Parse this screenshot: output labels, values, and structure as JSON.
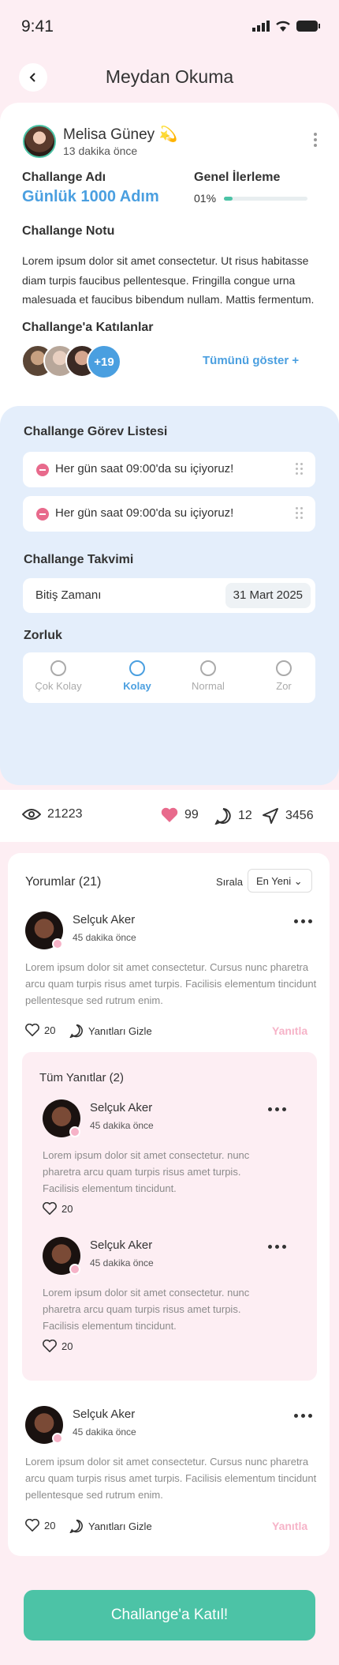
{
  "status": {
    "time": "9:41"
  },
  "header": {
    "title": "Meydan Okuma"
  },
  "post": {
    "user_name": "Melisa Güney",
    "emoji": "💫",
    "time": "13 dakika önce",
    "challenge_name_label": "Challange Adı",
    "challenge_name": "Günlük 1000 Adım",
    "progress_label": "Genel İlerleme",
    "progress_text": "01%",
    "progress_value": 0.1,
    "note_label": "Challange Notu",
    "note": "Lorem ipsum dolor sit amet consectetur. Ut risus habitasse diam turpis faucibus pellentesque. Fringilla congue urna malesuada et faucibus bibendum nullam. Mattis fermentum.",
    "participants_label": "Challange'a Katılanlar",
    "more_count": "+19",
    "show_all": "Tümünü göster +"
  },
  "tasks": {
    "title": "Challange Görev Listesi",
    "items": [
      "Her gün saat 09:00'da su içiyoruz!",
      "Her gün saat 09:00'da su içiyoruz!"
    ]
  },
  "calendar": {
    "title": "Challange Takvimi",
    "end_label": "Bitiş Zamanı",
    "end_value": "31 Mart 2025"
  },
  "difficulty": {
    "title": "Zorluk",
    "options": [
      "Çok Kolay",
      "Kolay",
      "Normal",
      "Zor"
    ],
    "selected": "Kolay"
  },
  "stats": {
    "views": "21223",
    "likes": "99",
    "comments": "12",
    "shares": "3456"
  },
  "comments": {
    "title": "Yorumlar (21)",
    "sort_label": "Sırala",
    "sort_value": "En Yeni",
    "replies_title": "Tüm Yanıtlar (2)",
    "items": [
      {
        "name": "Selçuk Aker",
        "time": "45 dakika önce",
        "body": "Lorem ipsum dolor sit amet consectetur. Cursus nunc pharetra arcu quam turpis risus amet turpis. Facilisis elementum tincidunt pellentesque sed rutrum enim.",
        "likes": "20",
        "hide": "Yanıtları Gizle",
        "reply": "Yanıtla"
      },
      {
        "name": "Selçuk Aker",
        "time": "45 dakika önce",
        "body": "Lorem ipsum dolor sit amet consectetur. Cursus nunc pharetra arcu quam turpis risus amet turpis. Facilisis elementum tincidunt pellentesque sed rutrum enim.",
        "likes": "20",
        "hide": "Yanıtları Gizle",
        "reply": "Yanıtla"
      }
    ],
    "replies": [
      {
        "name": "Selçuk Aker",
        "time": "45 dakika önce",
        "body": "Lorem ipsum dolor sit amet consectetur.  nunc pharetra arcu quam turpis risus amet turpis. Facilisis elementum tincidunt.",
        "likes": "20"
      },
      {
        "name": "Selçuk Aker",
        "time": "45 dakika önce",
        "body": "Lorem ipsum dolor sit amet consectetur.  nunc pharetra arcu quam turpis risus amet turpis. Facilisis elementum tincidunt.",
        "likes": "20"
      }
    ]
  },
  "cta": {
    "label": "Challange'a Katıl!"
  },
  "colors": {
    "accent_blue": "#4a9fe0",
    "accent_green": "#4cc3a6",
    "pink": "#f6b3c8",
    "bg_pink": "#fdeef3",
    "card_blue": "#e4eefb"
  }
}
